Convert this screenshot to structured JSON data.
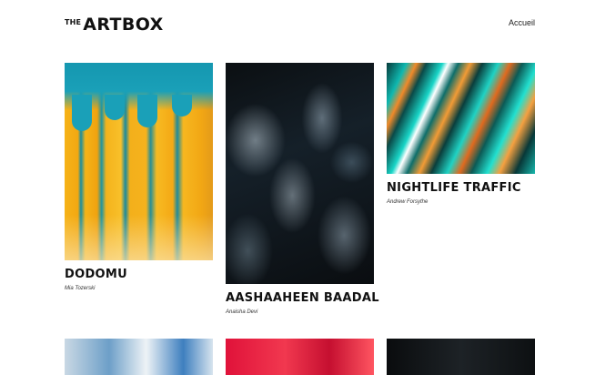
{
  "header": {
    "logo_small": "THE",
    "logo_big": "ARTBOX",
    "nav_link": "Accueil"
  },
  "artworks": [
    {
      "title": "DODOMU",
      "artist": "Mia Tozerski"
    },
    {
      "title": "AASHAAHEEN BAADAL",
      "artist": "Anaisha Devi"
    },
    {
      "title": "NIGHTLIFE TRAFFIC",
      "artist": "Andrew Forsythe"
    }
  ],
  "colors": {
    "text": "#111111",
    "background": "#ffffff"
  }
}
